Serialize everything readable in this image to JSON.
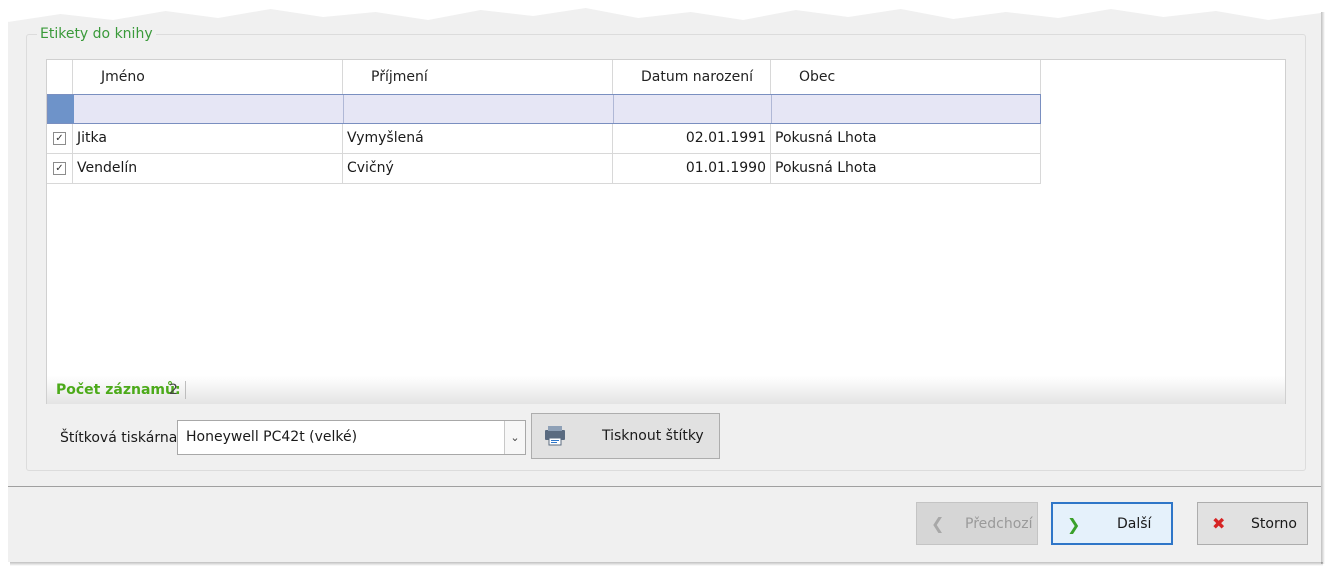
{
  "group": {
    "title": "Etikety do knihy"
  },
  "grid": {
    "columns": [
      "Jméno",
      "Příjmení",
      "Datum narození",
      "Obec"
    ],
    "rows": [
      {
        "checked": true,
        "jmeno": "Jitka",
        "prijmeni": "Vymyšlená",
        "datum": "02.01.1991",
        "obec": "Pokusná Lhota"
      },
      {
        "checked": true,
        "jmeno": "Vendelín",
        "prijmeni": "Cvičný",
        "datum": "01.01.1990",
        "obec": "Pokusná Lhota"
      }
    ],
    "status": {
      "label": "Počet záznamů:",
      "count": "2"
    }
  },
  "printer": {
    "label": "Štítková tiskárna",
    "selected": "Honeywell PC42t (velké)",
    "print_button": "Tisknout štítky"
  },
  "footer": {
    "prev": "Předchozí",
    "next": "Další",
    "cancel": "Storno"
  },
  "icons": {
    "check": "✓",
    "dropdown": "⌄",
    "prev": "❮",
    "next": "❯",
    "cancel": "✖"
  },
  "colors": {
    "accent_green": "#3a9a3a",
    "status_green": "#4caa1a",
    "next_border": "#2f76c8",
    "cancel_red": "#d62424",
    "filter_bg": "#e6e6f5"
  }
}
